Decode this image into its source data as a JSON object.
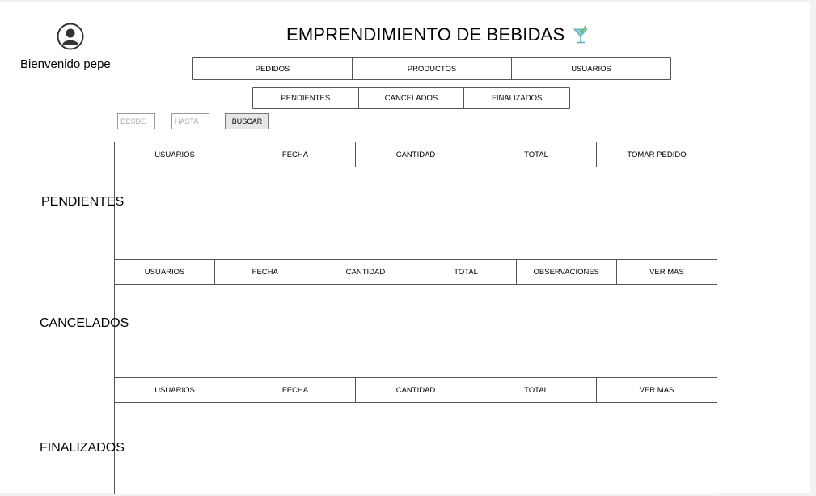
{
  "header": {
    "welcome": "Bienvenido pepe",
    "title": "EMPRENDIMIENTO DE BEBIDAS",
    "avatar_icon": "user-avatar-icon",
    "logo_icon": "cocktail-glass-icon"
  },
  "main_nav": [
    "PEDIDOS",
    "PRODUCTOS",
    "USUARIOS"
  ],
  "sub_nav": [
    "PENDIENTES",
    "CANCELADOS",
    "FINALIZADOS"
  ],
  "filters": {
    "from_placeholder": "DESDE",
    "to_placeholder": "HASTA",
    "search_label": "BUSCAR"
  },
  "sections": {
    "pending": {
      "label": "PENDIENTES",
      "columns": [
        "USUARIOS",
        "FECHA",
        "CANTIDAD",
        "TOTAL",
        "TOMAR PEDIDO"
      ]
    },
    "cancelled": {
      "label": "CANCELADOS",
      "columns": [
        "USUARIOS",
        "FECHA",
        "CANTIDAD",
        "TOTAL",
        "OBSERVACIONES",
        "VER MAS"
      ]
    },
    "finished": {
      "label": "FINALIZADOS",
      "columns": [
        "USUARIOS",
        "FECHA",
        "CANTIDAD",
        "TOTAL",
        "VER MAS"
      ]
    }
  },
  "colors": {
    "border": "#555555",
    "button_bg": "#e6e6e6",
    "logo_liquid": "#7fd3e6",
    "logo_garnish": "#7cb342"
  }
}
